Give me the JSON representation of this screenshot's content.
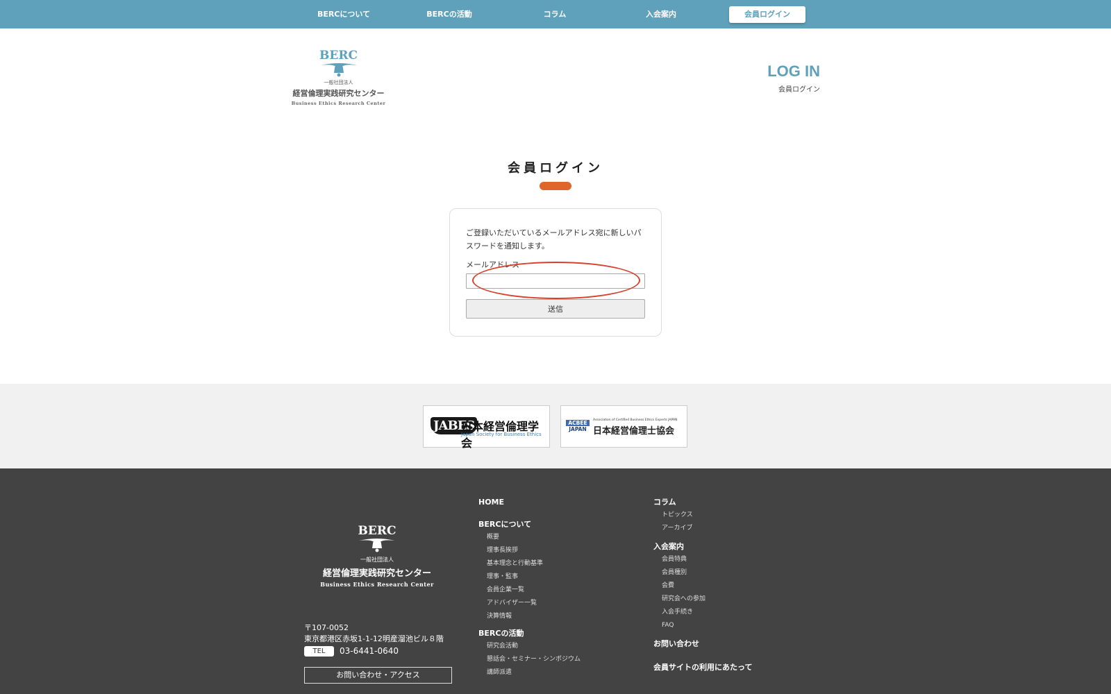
{
  "nav": {
    "items": [
      "BERCについて",
      "BERCの活動",
      "コラム",
      "入会案内"
    ],
    "login_label": "会員ログイン"
  },
  "header": {
    "logo": {
      "brand": "BERC",
      "sub": "一般社団法人",
      "jp": "経営倫理実践研究センター",
      "en": "Business Ethics Research Center"
    },
    "login_big": "LOG IN",
    "login_small": "会員ログイン"
  },
  "main": {
    "title": "会員ログイン",
    "description": "ご登録いただいているメールアドレス宛に新しいパスワードを通知します。",
    "email_label": "メールアドレス",
    "email_value": "",
    "submit_label": "送信"
  },
  "partners": {
    "jabes": {
      "logo_text": "JABES",
      "jp": "日本経営倫理学会",
      "en": "Japan Society for Business Ethics"
    },
    "acbee": {
      "logo_top": "ACBEE",
      "logo_bottom": "JAPAN",
      "top_line": "Association of Certified Business Ethics Experts JAPAN",
      "jp": "日本経営倫理士協会"
    }
  },
  "footer": {
    "logo": {
      "brand": "BERC",
      "sub": "一般社団法人",
      "jp": "経営倫理実践研究センター",
      "en": "Business Ethics Research Center"
    },
    "postal": "〒107-0052",
    "address": "東京都港区赤坂1-1-12明産溜池ビル８階",
    "tel_label": "TEL",
    "tel": "03-6441-0640",
    "contact_label": "お問い合わせ・アクセス",
    "col1": {
      "home": "HOME",
      "about": "BERCについて",
      "about_items": [
        "概要",
        "理事長挨拶",
        "基本理念と行動基準",
        "理事・監事",
        "会員企業一覧",
        "アドバイザー一覧",
        "決算情報"
      ],
      "activities": "BERCの活動",
      "activities_items": [
        "研究会活動",
        "懇話会・セミナー・シンポジウム",
        "講師派遣"
      ]
    },
    "col2": {
      "column": "コラム",
      "column_items": [
        "トピックス",
        "アーカイブ"
      ],
      "join": "入会案内",
      "join_items": [
        "会員特典",
        "会員種別",
        "会費",
        "研究会への参加",
        "入会手続き",
        "FAQ"
      ],
      "contact": "お問い合わせ",
      "member_site": "会員サイトの利用にあたって"
    }
  },
  "colors": {
    "nav_bg": "#5fa1bb",
    "accent": "#e0652a",
    "footer_bg": "#434343",
    "highlight": "#d9412c"
  }
}
